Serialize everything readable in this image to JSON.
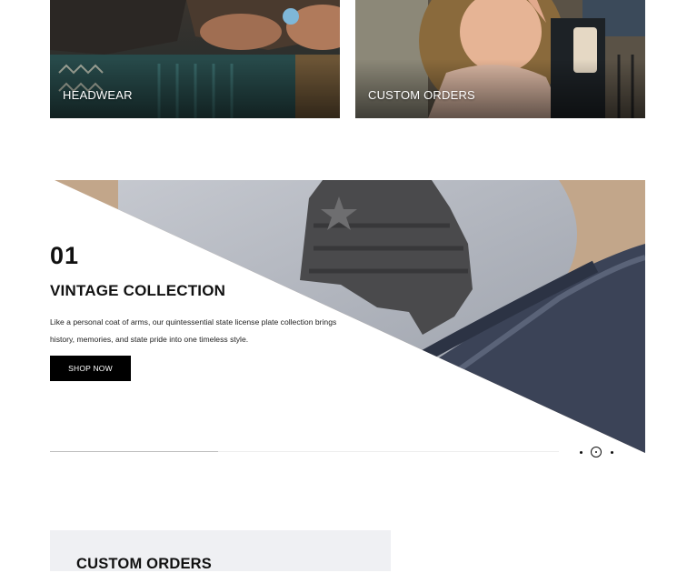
{
  "tiles": [
    {
      "label": "HEADWEAR"
    },
    {
      "label": "CUSTOM ORDERS"
    }
  ],
  "hero": {
    "slide_number": "01",
    "title": "VINTAGE COLLECTION",
    "description": "Like a personal coat of arms, our quintessential state license plate collection brings history, memories, and state pride into one timeless style.",
    "button_label": "SHOP NOW",
    "progress": 0.33,
    "slide_count": 3,
    "active_slide": 2
  },
  "custom_orders": {
    "title": "CUSTOM ORDERS"
  }
}
